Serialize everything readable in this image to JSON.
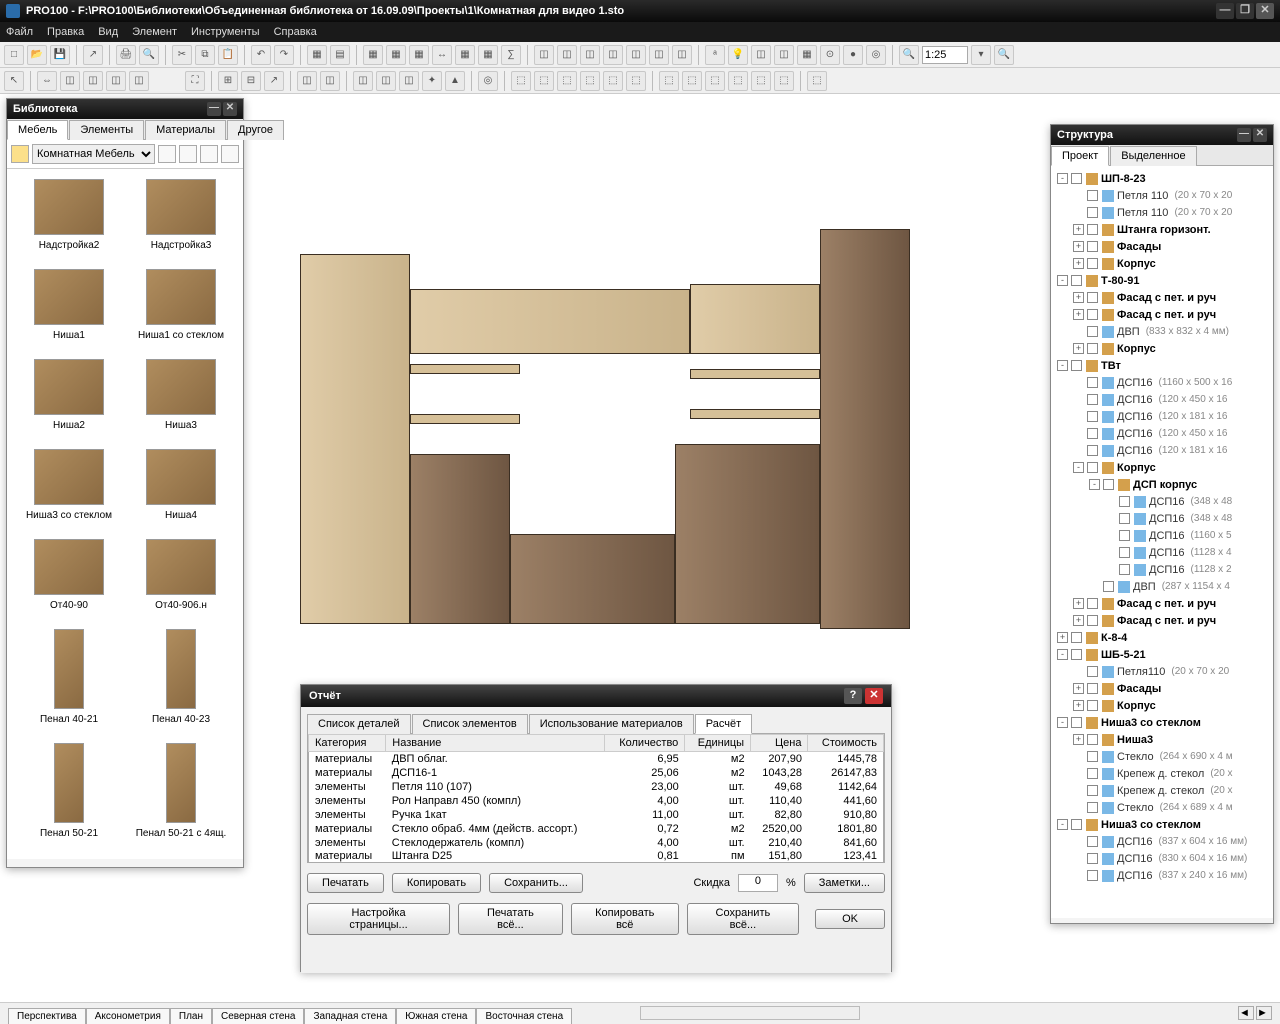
{
  "window": {
    "title": "PRO100 - F:\\PRO100\\Библиотеки\\Объединенная библиотека от 16.09.09\\Проекты\\1\\Комнатная для видео 1.sto"
  },
  "menu": [
    "Файл",
    "Правка",
    "Вид",
    "Элемент",
    "Инструменты",
    "Справка"
  ],
  "zoom": "1:25",
  "library": {
    "title": "Библиотека",
    "tabs": [
      "Мебель",
      "Элементы",
      "Материалы",
      "Другое"
    ],
    "active_tab": 0,
    "folder": "Комнатная Мебель",
    "items": [
      {
        "label": "Надстройка2"
      },
      {
        "label": "Надстройка3"
      },
      {
        "label": "Ниша1"
      },
      {
        "label": "Ниша1 со стеклом"
      },
      {
        "label": "Ниша2"
      },
      {
        "label": "Ниша3"
      },
      {
        "label": "Ниша3 со стеклом"
      },
      {
        "label": "Ниша4"
      },
      {
        "label": "От40-90"
      },
      {
        "label": "От40-906.н"
      },
      {
        "label": "Пенал 40-21",
        "tall": true
      },
      {
        "label": "Пенал 40-23",
        "tall": true
      },
      {
        "label": "Пенал 50-21",
        "tall": true
      },
      {
        "label": "Пенал 50-21 с 4ящ.",
        "tall": true
      }
    ]
  },
  "structure": {
    "title": "Структура",
    "tabs": [
      "Проект",
      "Выделенное"
    ],
    "active_tab": 0,
    "nodes": [
      {
        "d": 0,
        "e": "-",
        "g": true,
        "t": "ШП-8-23"
      },
      {
        "d": 1,
        "e": "",
        "t": "Петля 110",
        "dim": "(20 x 70 x 20"
      },
      {
        "d": 1,
        "e": "",
        "t": "Петля 110",
        "dim": "(20 x 70 x 20"
      },
      {
        "d": 1,
        "e": "+",
        "g": true,
        "t": "Штанга горизонт."
      },
      {
        "d": 1,
        "e": "+",
        "g": true,
        "t": "Фасады"
      },
      {
        "d": 1,
        "e": "+",
        "g": true,
        "t": "Корпус"
      },
      {
        "d": 0,
        "e": "-",
        "g": true,
        "t": "Т-80-91"
      },
      {
        "d": 1,
        "e": "+",
        "g": true,
        "t": "Фасад с пет. и руч"
      },
      {
        "d": 1,
        "e": "+",
        "g": true,
        "t": "Фасад с пет. и руч"
      },
      {
        "d": 1,
        "e": "",
        "t": "ДВП",
        "dim": "(833 x 832 x 4 мм)"
      },
      {
        "d": 1,
        "e": "+",
        "g": true,
        "t": "Корпус"
      },
      {
        "d": 0,
        "e": "-",
        "g": true,
        "t": "ТВт"
      },
      {
        "d": 1,
        "e": "",
        "t": "ДСП16",
        "dim": "(1160 x 500 x 16"
      },
      {
        "d": 1,
        "e": "",
        "t": "ДСП16",
        "dim": "(120 x 450 x 16"
      },
      {
        "d": 1,
        "e": "",
        "t": "ДСП16",
        "dim": "(120 x 181 x 16"
      },
      {
        "d": 1,
        "e": "",
        "t": "ДСП16",
        "dim": "(120 x 450 x 16"
      },
      {
        "d": 1,
        "e": "",
        "t": "ДСП16",
        "dim": "(120 x 181 x 16"
      },
      {
        "d": 1,
        "e": "-",
        "g": true,
        "t": "Корпус"
      },
      {
        "d": 2,
        "e": "-",
        "g": true,
        "t": "ДСП корпус"
      },
      {
        "d": 3,
        "e": "",
        "t": "ДСП16",
        "dim": "(348 x 48"
      },
      {
        "d": 3,
        "e": "",
        "t": "ДСП16",
        "dim": "(348 x 48"
      },
      {
        "d": 3,
        "e": "",
        "t": "ДСП16",
        "dim": "(1160 x 5"
      },
      {
        "d": 3,
        "e": "",
        "t": "ДСП16",
        "dim": "(1128 x 4"
      },
      {
        "d": 3,
        "e": "",
        "t": "ДСП16",
        "dim": "(1128 x 2"
      },
      {
        "d": 2,
        "e": "",
        "t": "ДВП",
        "dim": "(287 x 1154 x 4"
      },
      {
        "d": 1,
        "e": "+",
        "g": true,
        "t": "Фасад с пет. и руч"
      },
      {
        "d": 1,
        "e": "+",
        "g": true,
        "t": "Фасад с пет. и руч"
      },
      {
        "d": 0,
        "e": "+",
        "g": true,
        "t": "К-8-4"
      },
      {
        "d": 0,
        "e": "-",
        "g": true,
        "t": "ШБ-5-21"
      },
      {
        "d": 1,
        "e": "",
        "t": "Петля110",
        "dim": "(20 x 70 x 20"
      },
      {
        "d": 1,
        "e": "+",
        "g": true,
        "t": "Фасады"
      },
      {
        "d": 1,
        "e": "+",
        "g": true,
        "t": "Корпус"
      },
      {
        "d": 0,
        "e": "-",
        "g": true,
        "t": "Ниша3 со стеклом"
      },
      {
        "d": 1,
        "e": "+",
        "g": true,
        "t": "Ниша3"
      },
      {
        "d": 1,
        "e": "",
        "t": "Стекло",
        "dim": "(264 x 690 x 4 м"
      },
      {
        "d": 1,
        "e": "",
        "t": "Крепеж д. стекол",
        "dim": "(20 x"
      },
      {
        "d": 1,
        "e": "",
        "t": "Крепеж д. стекол",
        "dim": "(20 x"
      },
      {
        "d": 1,
        "e": "",
        "t": "Стекло",
        "dim": "(264 x 689 x 4 м"
      },
      {
        "d": 0,
        "e": "-",
        "g": true,
        "t": "Ниша3 со стеклом"
      },
      {
        "d": 1,
        "e": "",
        "t": "ДСП16",
        "dim": "(837 x 604 x 16 мм)"
      },
      {
        "d": 1,
        "e": "",
        "t": "ДСП16",
        "dim": "(830 x 604 x 16 мм)"
      },
      {
        "d": 1,
        "e": "",
        "t": "ДСП16",
        "dim": "(837 x 240 x 16 мм)"
      }
    ]
  },
  "report": {
    "title": "Отчёт",
    "tabs": [
      "Список деталей",
      "Список элементов",
      "Использование материалов",
      "Расчёт"
    ],
    "active_tab": 3,
    "columns": [
      "Категория",
      "Название",
      "Количество",
      "Единицы",
      "Цена",
      "Стоимость"
    ],
    "rows": [
      [
        "материалы",
        "ДВП облаг.",
        "6,95",
        "м2",
        "207,90",
        "1445,78"
      ],
      [
        "материалы",
        "ДСП16-1",
        "25,06",
        "м2",
        "1043,28",
        "26147,83"
      ],
      [
        "элементы",
        "Петля 110 (107)",
        "23,00",
        "шт.",
        "49,68",
        "1142,64"
      ],
      [
        "элементы",
        "Рол Направл 450 (компл)",
        "4,00",
        "шт.",
        "110,40",
        "441,60"
      ],
      [
        "элементы",
        "Ручка 1кат",
        "11,00",
        "шт.",
        "82,80",
        "910,80"
      ],
      [
        "материалы",
        "Стекло обраб. 4мм (действ. ассорт.)",
        "0,72",
        "м2",
        "2520,00",
        "1801,80"
      ],
      [
        "элементы",
        "Стеклодержатель (компл)",
        "4,00",
        "шт.",
        "210,40",
        "841,60"
      ],
      [
        "материалы",
        "Штанга D25",
        "0,81",
        "пм",
        "151,80",
        "123,41"
      ]
    ],
    "discount_label": "Скидка",
    "discount_value": "0",
    "buttons": {
      "print": "Печатать",
      "copy": "Копировать",
      "save": "Сохранить...",
      "notes": "Заметки...",
      "page_setup": "Настройка страницы...",
      "print_all": "Печатать всё...",
      "copy_all": "Копировать всё",
      "save_all": "Сохранить всё...",
      "ok": "OK"
    }
  },
  "status_tabs": [
    "Перспектива",
    "Аксонометрия",
    "План",
    "Северная стена",
    "Западная стена",
    "Южная стена",
    "Восточная стена"
  ]
}
